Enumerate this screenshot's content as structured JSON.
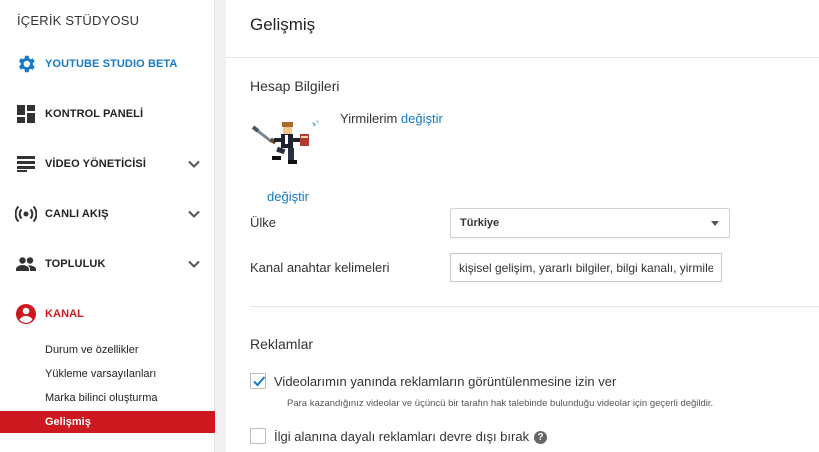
{
  "sidebar": {
    "title": "İÇERİK STÜDYOSU",
    "items": [
      {
        "label": "YOUTUBE STUDIO BETA",
        "icon": "gear-icon"
      },
      {
        "label": "KONTROL PANELİ",
        "icon": "dashboard-icon"
      },
      {
        "label": "VİDEO YÖNETİCİSİ",
        "icon": "video-manager-icon"
      },
      {
        "label": "CANLI AKIŞ",
        "icon": "live-stream-icon"
      },
      {
        "label": "TOPLULUK",
        "icon": "community-icon"
      },
      {
        "label": "KANAL",
        "icon": "channel-icon"
      }
    ],
    "subitems": [
      {
        "label": "Durum ve özellikler"
      },
      {
        "label": "Yükleme varsayılanları"
      },
      {
        "label": "Marka bilinci oluşturma"
      },
      {
        "label": "Gelişmiş"
      }
    ],
    "colors": {
      "accent_blue": "#167ac6",
      "accent_red": "#cc181e"
    }
  },
  "main": {
    "title": "Gelişmiş",
    "account": {
      "section_title": "Hesap Bilgileri",
      "channel_name": "Yirmilerim",
      "change_name_link": "değiştir",
      "change_avatar_link": "değiştir",
      "country_label": "Ülke",
      "country_value": "Türkiye",
      "keywords_label": "Kanal anahtar kelimeleri",
      "keywords_value": "kişisel gelişim, yararlı bilgiler, bilgi kanalı, yirmilerim"
    },
    "ads": {
      "section_title": "Reklamlar",
      "allow_ads_label": "Videolarımın yanında reklamların görüntülenmesine izin ver",
      "allow_ads_checked": true,
      "allow_ads_note": "Para kazandığınız videolar ve üçüncü bir tarafın hak talebinde bulunduğu videolar için geçerli değildir.",
      "interest_ads_label": "İlgi alanına dayalı reklamları devre dışı bırak",
      "interest_ads_checked": false,
      "help_icon": "help-icon"
    }
  }
}
